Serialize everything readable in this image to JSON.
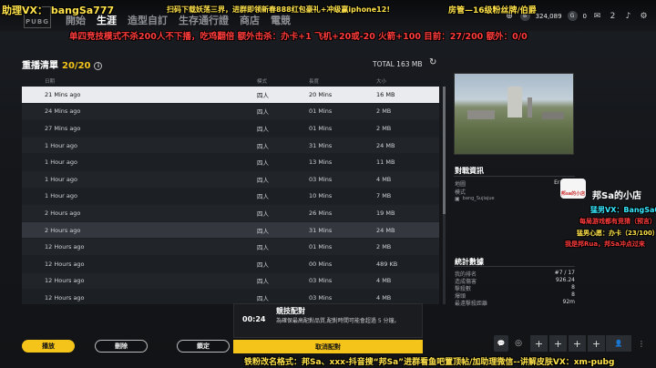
{
  "overlay": {
    "assistant": "助理VX： bangSa777",
    "scan": "扫码下载妖荡三界，进群即领新春888红包豪礼+冲级赢iphone12!",
    "manager": "房管—16级粉丝牌/伯爵",
    "rules": "单四竞技模式不杀200人不下播，吃鸡翻倍 额外击杀：办卡+1 飞机+20或-20 火箭+100 目前：27/200 额外：0/0",
    "bottom": "铁粉改名格式：邦Sa、xxx-抖音搜“邦Sa”进群看鱼吧置顶帖/加助理微信--讲解皮肤VX：xm-pubg",
    "shop_badge": "邦sa的小店",
    "shop_name": "邦Sa的小店",
    "r1": "猛男VX：BangSa002",
    "r2": "每局游戏都有竞猜（预言）",
    "r3": "猛男心愿：办卡（23/100）",
    "r4": "我是邦Rua，邦Sa冲点过来"
  },
  "nav": {
    "logo": "PUBG",
    "items": [
      "開始",
      "生涯",
      "造型自訂",
      "生存通行證",
      "商店",
      "電競"
    ]
  },
  "top": {
    "bp": "324,089",
    "g": "0",
    "badge": "2"
  },
  "panel": {
    "title": "重播清單",
    "count": "20/20",
    "total": "TOTAL 163 MB",
    "columns": [
      "日期",
      "模式",
      "長度",
      "大小"
    ]
  },
  "replays": [
    {
      "date": "21 Mins ago",
      "mode": "四人",
      "len": "20 Mins",
      "size": "16 MB"
    },
    {
      "date": "24 Mins ago",
      "mode": "四人",
      "len": "01 Mins",
      "size": "2 MB"
    },
    {
      "date": "27 Mins ago",
      "mode": "四人",
      "len": "01 Mins",
      "size": "2 MB"
    },
    {
      "date": "1 Hour ago",
      "mode": "四人",
      "len": "31 Mins",
      "size": "24 MB"
    },
    {
      "date": "1 Hour ago",
      "mode": "四人",
      "len": "13 Mins",
      "size": "11 MB"
    },
    {
      "date": "1 Hour ago",
      "mode": "四人",
      "len": "03 Mins",
      "size": "4 MB"
    },
    {
      "date": "1 Hour ago",
      "mode": "四人",
      "len": "10 Mins",
      "size": "7 MB"
    },
    {
      "date": "2 Hours ago",
      "mode": "四人",
      "len": "26 Mins",
      "size": "19 MB"
    },
    {
      "date": "2 Hours ago",
      "mode": "四人",
      "len": "31 Mins",
      "size": "24 MB"
    },
    {
      "date": "12 Hours ago",
      "mode": "四人",
      "len": "01 Mins",
      "size": "2 MB"
    },
    {
      "date": "12 Hours ago",
      "mode": "四人",
      "len": "00 Mins",
      "size": "489 KB"
    },
    {
      "date": "12 Hours ago",
      "mode": "四人",
      "len": "03 Mins",
      "size": "4 MB"
    },
    {
      "date": "12 Hours ago",
      "mode": "四人",
      "len": "03 Mins",
      "size": "4 MB"
    }
  ],
  "match_info": {
    "title": "對戰資訊",
    "map_label": "地圖",
    "map_value": "Erangel",
    "mode_label": "模式",
    "players": "bang_Sujiajue"
  },
  "stats": {
    "title": "統計數據",
    "rows": [
      {
        "k": "我的排名",
        "v": "#7 / 17"
      },
      {
        "k": "造成傷害",
        "v": "926.24"
      },
      {
        "k": "擊殺數",
        "v": "8"
      },
      {
        "k": "爆頭",
        "v": "8"
      },
      {
        "k": "最遠擊殺距離",
        "v": "92m"
      }
    ]
  },
  "matchmaking": {
    "time": "00:24",
    "title": "競技配對",
    "desc": "為確保最高配對品質,配對時間可能會超過 5 分鐘。",
    "cancel": "取消配對"
  },
  "buttons": {
    "play": "播放",
    "delete": "刪除",
    "lock": "鎖定"
  }
}
